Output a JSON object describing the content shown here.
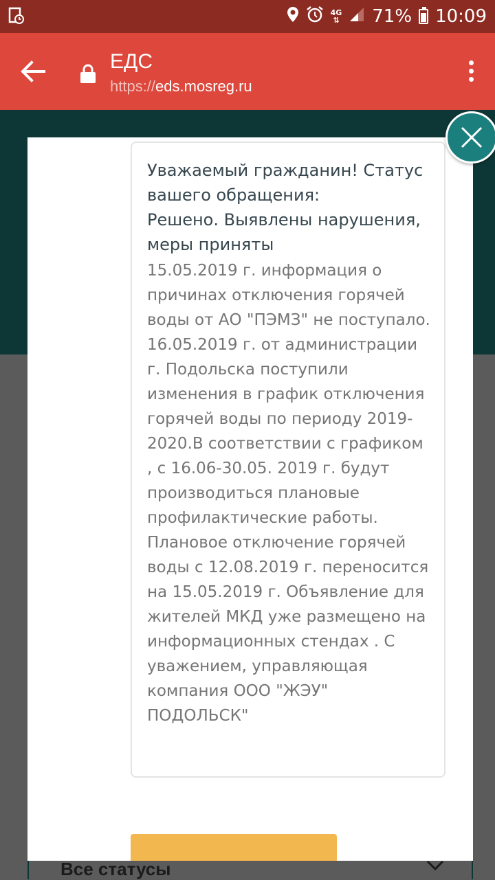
{
  "status_bar": {
    "network": "4G",
    "battery": "71%",
    "battery_level": 0.71,
    "time": "10:09",
    "icons": [
      "screenshot-icon",
      "location-icon",
      "alarm-icon",
      "network-4g-icon",
      "signal-icon",
      "battery-icon"
    ]
  },
  "app_bar": {
    "title": "ЕДС",
    "url_scheme": "https://",
    "url_host": "eds.mosreg.ru",
    "icons": [
      "back-arrow-icon",
      "lock-icon",
      "more-vert-icon"
    ]
  },
  "modal": {
    "heading": "Уважаемый гражданин! Статус вашего обращения:\nРешено. Выявлены нарушения, меры приняты",
    "body": "15.05.2019 г. информация о причинах отключения горячей воды от АО \"ПЭМЗ\" не поступало. 16.05.2019 г. от администрации г. Подольска поступили изменения в график отключения горячей воды по периоду 2019-2020.В соответствии с графиком , с 16.06-30.05. 2019 г. будут производиться плановые профилактические работы. Плановое отключение горячей воды с 12.08.2019 г. переносится на 15.05.2019 г. Объявление для жителей МКД уже размещено на информационных стендах . С уважением, управляющая компания ООО \"ЖЭУ\" ПОДОЛЬСК\"",
    "close_icon": "close-icon"
  },
  "background": {
    "filter_label": "Все статусы",
    "filter_icon": "chevron-down-icon"
  },
  "colors": {
    "status_bar": "#8b2b22",
    "app_bar": "#dd473c",
    "dark_teal": "#0d3736",
    "close_button": "#1b7f7e",
    "action_button": "#f2b84f"
  }
}
